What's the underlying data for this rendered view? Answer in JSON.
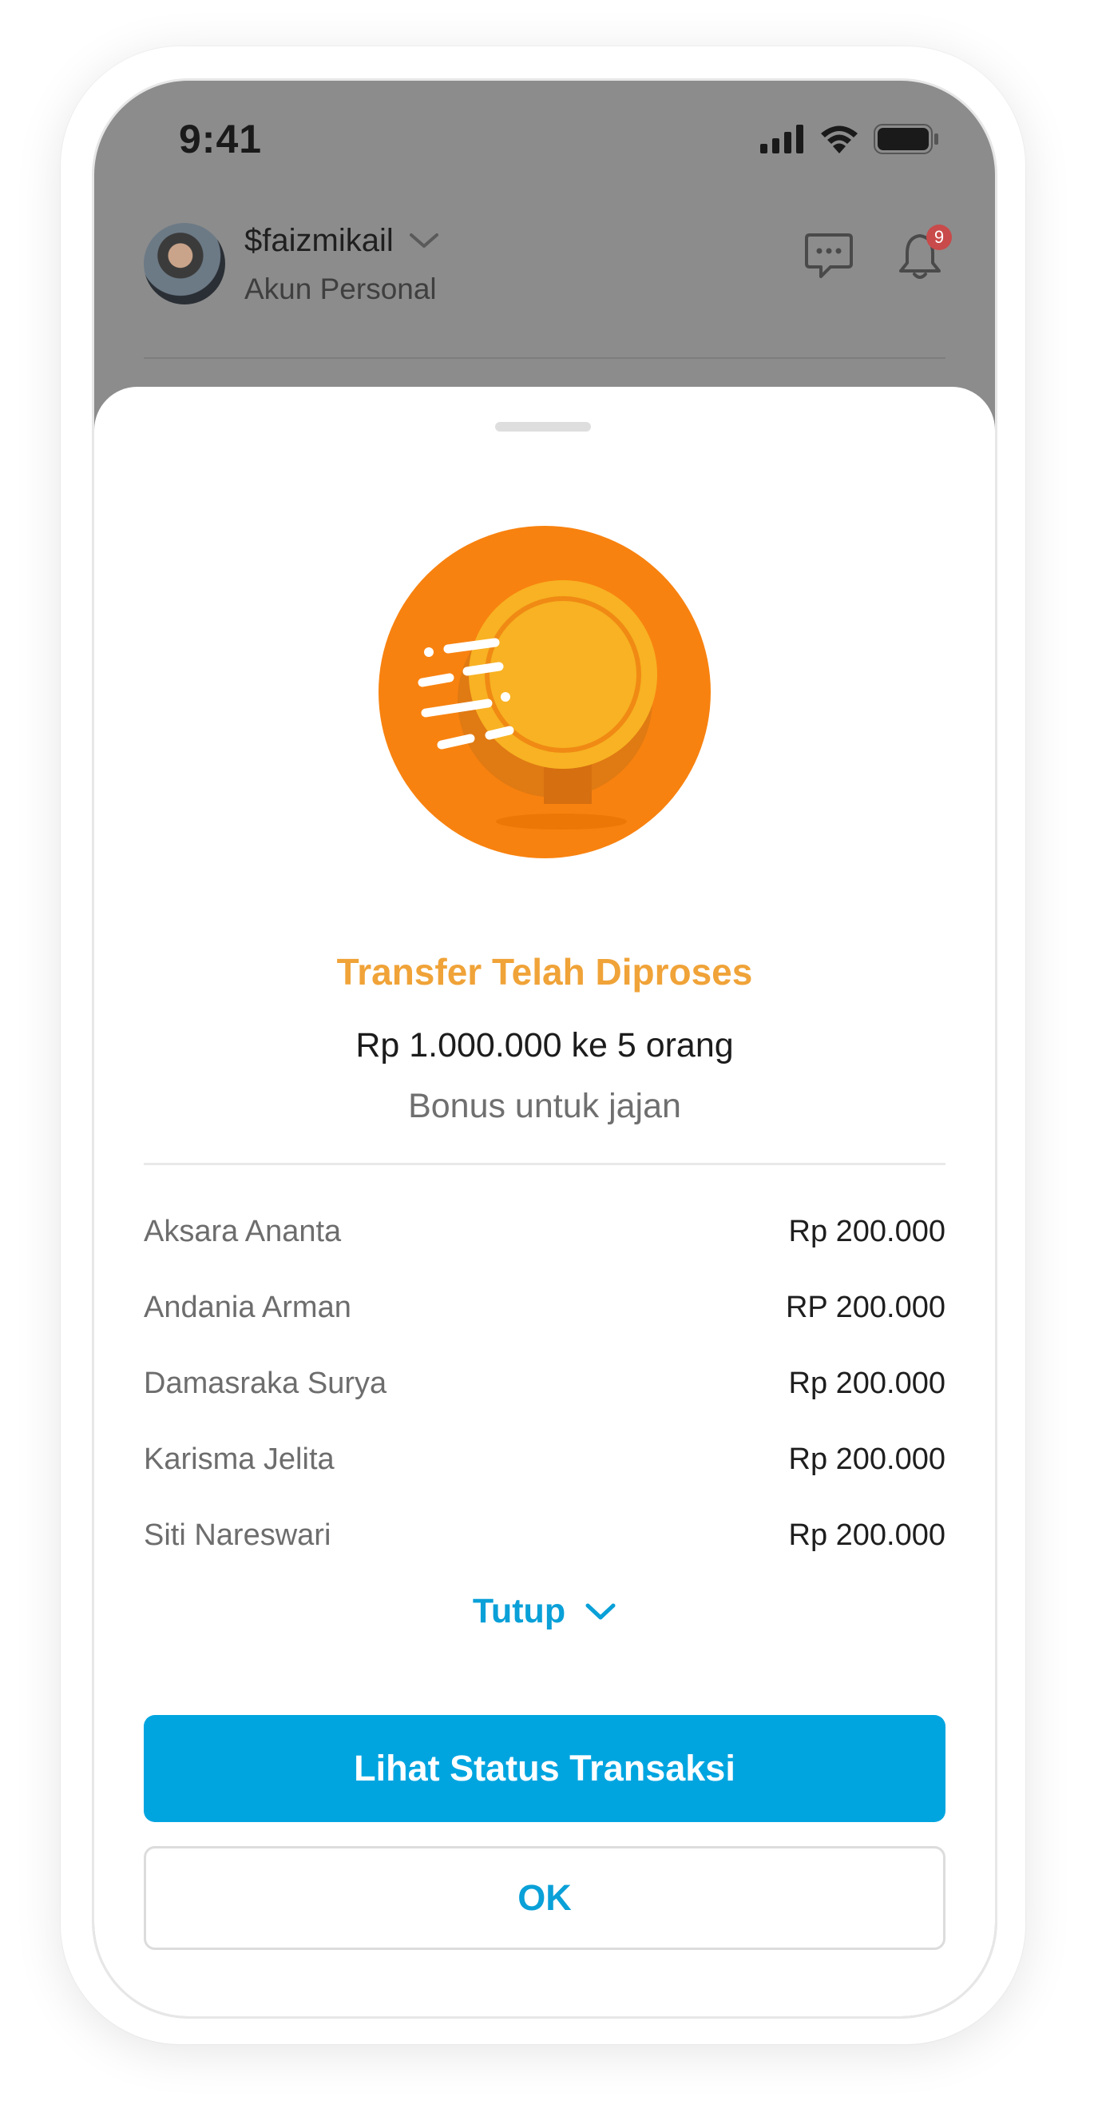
{
  "status_bar": {
    "time": "9:41"
  },
  "header": {
    "username": "$faizmikail",
    "account_type": "Akun Personal",
    "notification_count": "9"
  },
  "sheet": {
    "title": "Transfer Telah Diproses",
    "amount_line": "Rp 1.000.000 ke 5 orang",
    "note": "Bonus untuk jajan",
    "recipients": [
      {
        "name": "Aksara Ananta",
        "amount": "Rp 200.000"
      },
      {
        "name": "Andania Arman",
        "amount": "RP 200.000"
      },
      {
        "name": "Damasraka Surya",
        "amount": "Rp 200.000"
      },
      {
        "name": "Karisma Jelita",
        "amount": "Rp 200.000"
      },
      {
        "name": "Siti Nareswari",
        "amount": "Rp 200.000"
      }
    ],
    "collapse_label": "Tutup",
    "primary_button": "Lihat Status Transaksi",
    "secondary_button": "OK"
  },
  "colors": {
    "accent": "#00a5e0",
    "title": "#f0a338",
    "coin_bg": "#f8820f",
    "coin": "#f8b223",
    "badge": "#c94a4a"
  }
}
